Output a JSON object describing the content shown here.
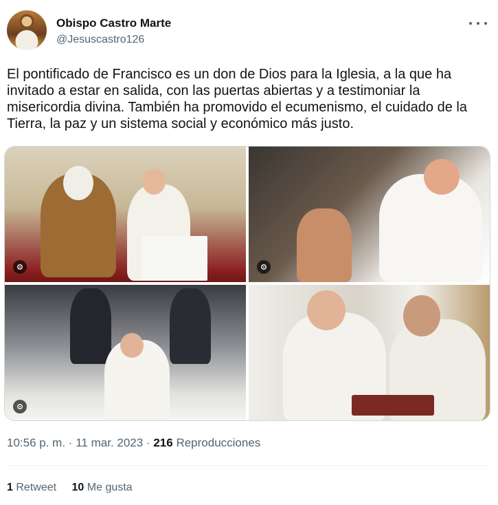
{
  "author": {
    "name": "Obispo Castro Marte",
    "handle": "@Jesuscastro126"
  },
  "icons": {
    "more": "more-horizontal-icon",
    "alt": "image-alt-icon"
  },
  "tweet": {
    "text": "El pontificado de Francisco es un don de Dios para la Iglesia, a la que ha invitado a estar en salida, con las puertas abiertas y a testimoniar la misericordia divina. También ha promovido el ecumenismo, el cuidado de la Tierra, la paz y un sistema social y económico más justo."
  },
  "meta": {
    "time": "10:56 p. m.",
    "separator": "·",
    "date": "11 mar. 2023",
    "views_count": "216",
    "views_label": "Reproducciones"
  },
  "stats": {
    "retweets_count": "1",
    "retweets_label": "Retweet",
    "likes_count": "10",
    "likes_label": "Me gusta"
  }
}
